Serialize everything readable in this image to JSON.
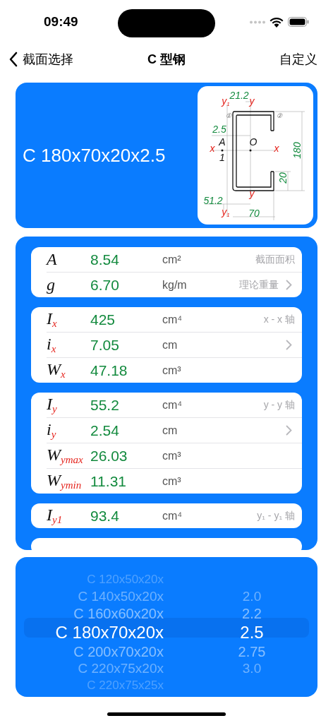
{
  "status_bar": {
    "time": "09:49"
  },
  "nav": {
    "back": "截面选择",
    "title": "C 型钢",
    "action": "自定义"
  },
  "section": {
    "name": "C 180x70x20x2.5",
    "diagram": {
      "labels": [
        {
          "kind": "dimension",
          "text": "21.2"
        },
        {
          "kind": "axis",
          "text": "y",
          "sub": "1"
        },
        {
          "kind": "axis",
          "text": "y"
        },
        {
          "kind": "marker",
          "text": "①"
        },
        {
          "kind": "marker",
          "text": "②"
        },
        {
          "kind": "dimension",
          "text": "2.5"
        },
        {
          "kind": "point",
          "text": "A"
        },
        {
          "kind": "point",
          "text": "O"
        },
        {
          "kind": "axis",
          "text": "x"
        },
        {
          "kind": "axis",
          "text": "x"
        },
        {
          "kind": "point",
          "text": "1"
        },
        {
          "kind": "dimension",
          "text": "180"
        },
        {
          "kind": "dimension",
          "text": "20"
        },
        {
          "kind": "axis",
          "text": "y"
        },
        {
          "kind": "dimension",
          "text": "51.2"
        },
        {
          "kind": "axis",
          "text": "y",
          "sub": "1"
        },
        {
          "kind": "dimension",
          "text": "70"
        }
      ]
    }
  },
  "groups": [
    {
      "rows": [
        {
          "symbol": "A",
          "value": "8.54",
          "unit": "cm²",
          "note": "截面面积",
          "chevron": false
        },
        {
          "symbol": "g",
          "value": "6.70",
          "unit": "kg/m",
          "note": "理论重量",
          "chevron": true
        }
      ]
    },
    {
      "rows": [
        {
          "symbol": "I",
          "sub": "x",
          "value": "425",
          "unit": "cm⁴",
          "note": "x - x 轴",
          "chevron": false
        },
        {
          "symbol": "i",
          "sub": "x",
          "value": "7.05",
          "unit": "cm",
          "chevron": true
        },
        {
          "symbol": "W",
          "sub": "x",
          "value": "47.18",
          "unit": "cm³",
          "chevron": false
        }
      ]
    },
    {
      "rows": [
        {
          "symbol": "I",
          "sub": "y",
          "value": "55.2",
          "unit": "cm⁴",
          "note": "y - y 轴",
          "chevron": false
        },
        {
          "symbol": "i",
          "sub": "y",
          "value": "2.54",
          "unit": "cm",
          "chevron": true
        },
        {
          "symbol": "W",
          "sub": "ymax",
          "value": "26.03",
          "unit": "cm³",
          "chevron": false
        },
        {
          "symbol": "W",
          "sub": "ymin",
          "value": "11.31",
          "unit": "cm³",
          "chevron": false
        }
      ]
    },
    {
      "rows": [
        {
          "symbol": "I",
          "sub": "y1",
          "value": "93.4",
          "unit": "cm⁴",
          "note": "y₁ - y₁ 轴",
          "chevron": false
        }
      ]
    }
  ],
  "picker": {
    "sizes": [
      {
        "text": "C 120x50x20x",
        "selected": false
      },
      {
        "text": "C 140x50x20x",
        "selected": false
      },
      {
        "text": "C 160x60x20x",
        "selected": false
      },
      {
        "text": "C 180x70x20x",
        "selected": true
      },
      {
        "text": "C 200x70x20x",
        "selected": false
      },
      {
        "text": "C 220x75x20x",
        "selected": false
      },
      {
        "text": "C 220x75x25x",
        "selected": false
      }
    ],
    "thicknesses": [
      {
        "text": "2.0",
        "selected": false
      },
      {
        "text": "2.2",
        "selected": false
      },
      {
        "text": "2.5",
        "selected": true
      },
      {
        "text": "2.75",
        "selected": false
      },
      {
        "text": "3.0",
        "selected": false
      }
    ]
  }
}
